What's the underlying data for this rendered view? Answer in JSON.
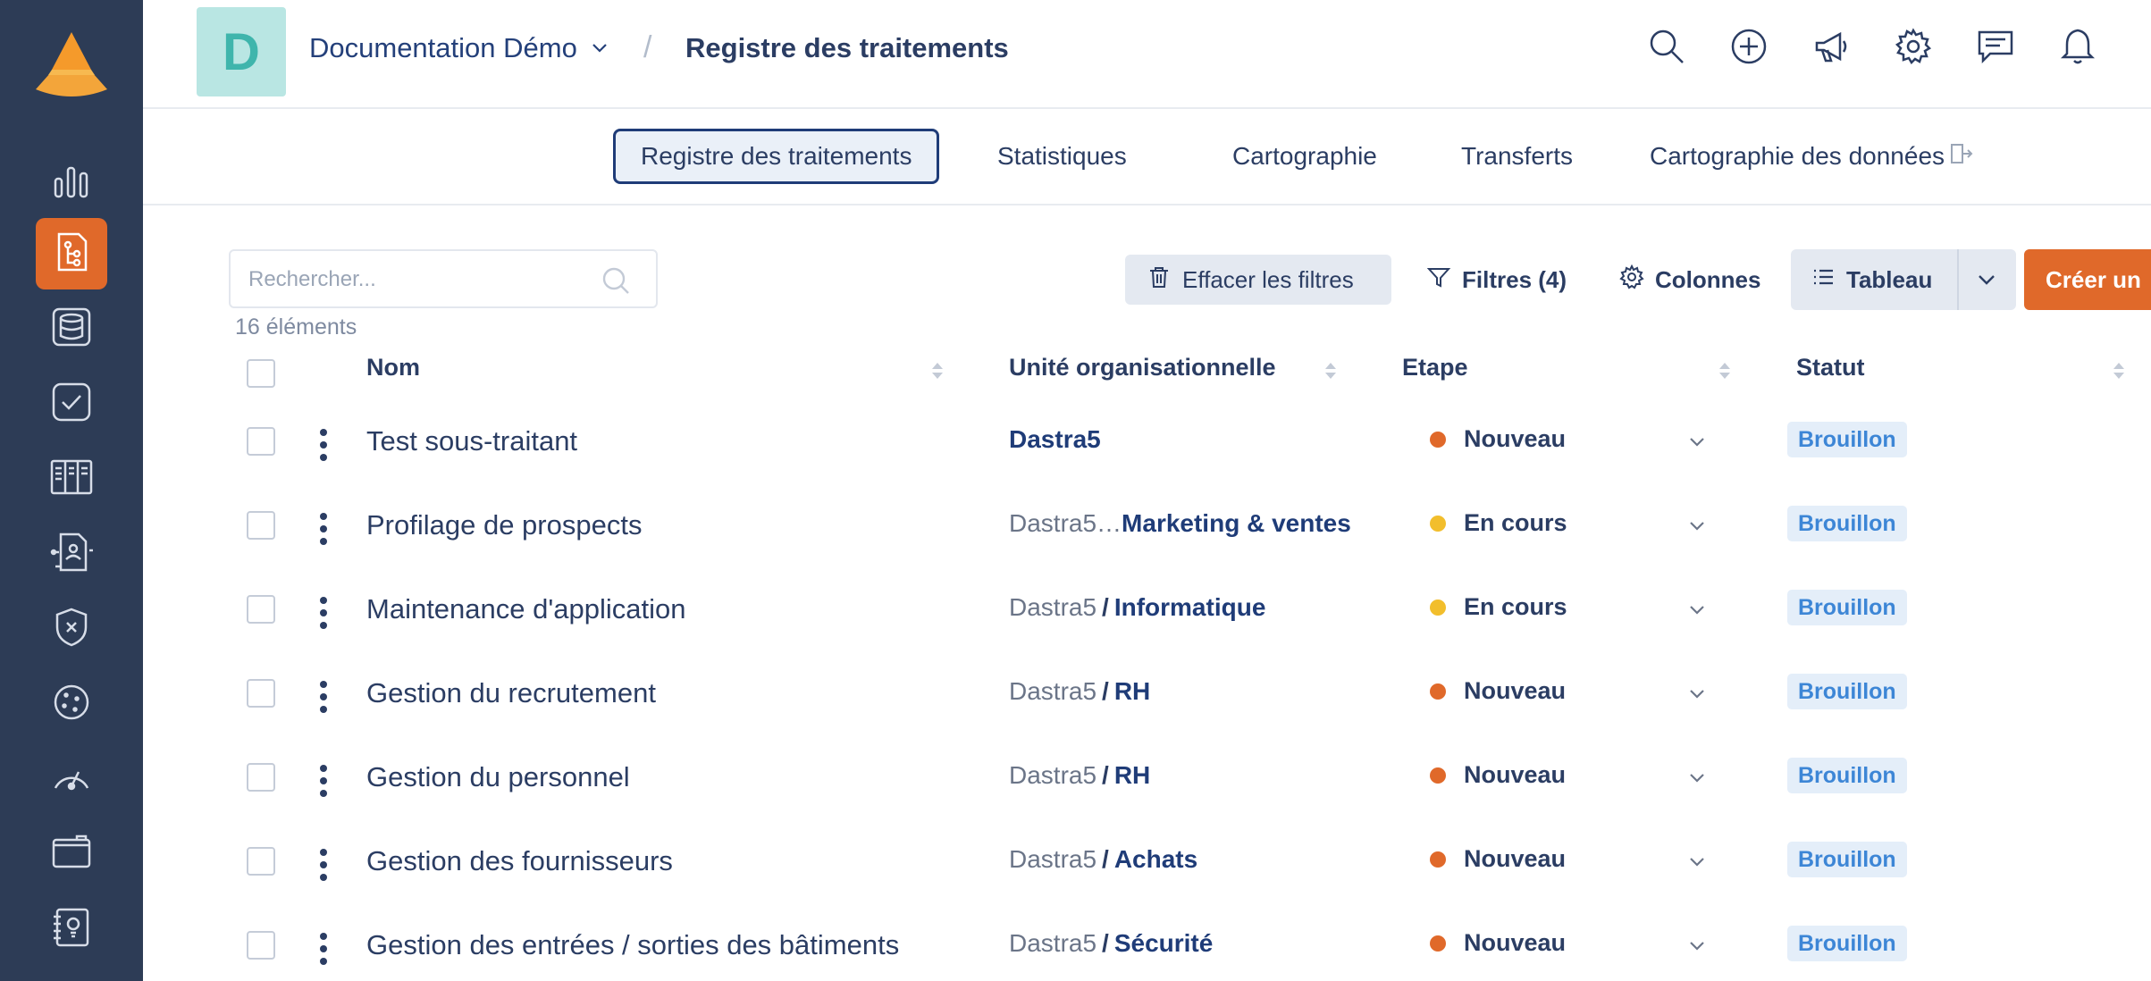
{
  "header": {
    "avatar_letter": "D",
    "workspace": "Documentation Démo",
    "separator": "/",
    "page_title": "Registre des traitements",
    "icons": [
      "search-icon",
      "add-circle-icon",
      "megaphone-icon",
      "gear-icon",
      "chat-icon",
      "bell-icon"
    ]
  },
  "sidebar": {
    "items": [
      {
        "icon": "bar-chart-icon"
      },
      {
        "icon": "processing-register-icon",
        "active": true
      },
      {
        "icon": "database-icon"
      },
      {
        "icon": "task-check-icon"
      },
      {
        "icon": "table-view-icon"
      },
      {
        "icon": "person-network-icon"
      },
      {
        "icon": "shield-x-icon"
      },
      {
        "icon": "cookie-icon"
      },
      {
        "icon": "gauge-icon"
      },
      {
        "icon": "folder-icon"
      },
      {
        "icon": "notebook-idea-icon"
      }
    ]
  },
  "tabs": [
    {
      "label": "Registre des traitements",
      "active": true
    },
    {
      "label": "Statistiques"
    },
    {
      "label": "Cartographie"
    },
    {
      "label": "Transferts"
    },
    {
      "label": "Cartographie des données"
    }
  ],
  "toolbar": {
    "search_placeholder": "Rechercher...",
    "count": "16 éléments",
    "clear_filters": "Effacer les filtres",
    "filters": "Filtres (4)",
    "columns": "Colonnes",
    "view": "Tableau",
    "create": "Créer un"
  },
  "table": {
    "headers": {
      "name": "Nom",
      "unit": "Unité organisationnelle",
      "etape": "Etape",
      "statut": "Statut"
    },
    "rows": [
      {
        "name": "Test sous-traitant",
        "unit_parent": "",
        "unit_sep": "",
        "unit_child": "Dastra5",
        "etape": "Nouveau",
        "etape_color": "#e0692a",
        "statut": "Brouillon"
      },
      {
        "name": "Profilage de prospects",
        "unit_parent": "Dastra5…",
        "unit_sep": "",
        "unit_child": "Marketing & ventes",
        "etape": "En cours",
        "etape_color": "#f2be2c",
        "statut": "Brouillon"
      },
      {
        "name": "Maintenance d'application",
        "unit_parent": "Dastra5",
        "unit_sep": "/",
        "unit_child": "Informatique",
        "etape": "En cours",
        "etape_color": "#f2be2c",
        "statut": "Brouillon"
      },
      {
        "name": "Gestion du recrutement",
        "unit_parent": "Dastra5",
        "unit_sep": "/",
        "unit_child": "RH",
        "etape": "Nouveau",
        "etape_color": "#e0692a",
        "statut": "Brouillon"
      },
      {
        "name": "Gestion du personnel",
        "unit_parent": "Dastra5",
        "unit_sep": "/",
        "unit_child": "RH",
        "etape": "Nouveau",
        "etape_color": "#e0692a",
        "statut": "Brouillon"
      },
      {
        "name": "Gestion des fournisseurs",
        "unit_parent": "Dastra5",
        "unit_sep": "/",
        "unit_child": "Achats",
        "etape": "Nouveau",
        "etape_color": "#e0692a",
        "statut": "Brouillon"
      },
      {
        "name": "Gestion des entrées / sorties des bâtiments",
        "unit_parent": "Dastra5",
        "unit_sep": "/",
        "unit_child": "Sécurité",
        "etape": "Nouveau",
        "etape_color": "#e0692a",
        "statut": "Brouillon"
      }
    ]
  },
  "colors": {
    "sidebar": "#2d3c56",
    "accent": "#e0692a",
    "primary_text": "#2b3d63",
    "badge_text": "#3d86d6",
    "badge_bg": "#e4eef9"
  }
}
